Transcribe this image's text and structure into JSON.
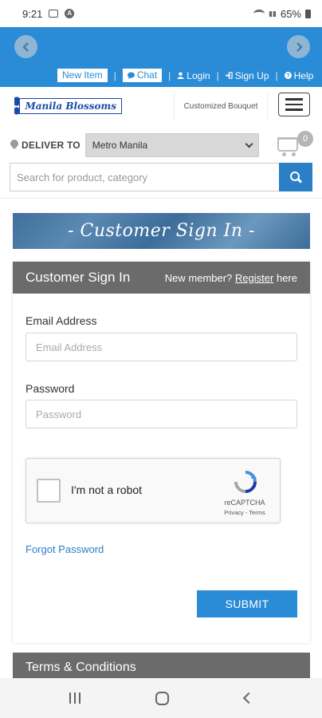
{
  "status_bar": {
    "time": "9:21",
    "battery": "65%"
  },
  "top_links": {
    "new_item": "New Item",
    "chat": "Chat",
    "login": "Login",
    "signup": "Sign Up",
    "help": "Help"
  },
  "header": {
    "logo_text": "Manila Blossoms",
    "bouquet_link": "Customized Bouquet"
  },
  "deliver": {
    "label": "DELIVER TO",
    "selected": "Metro Manila",
    "cart_count": "0"
  },
  "search": {
    "placeholder": "Search for product, category"
  },
  "banner": {
    "text": "- Customer Sign In -"
  },
  "signin": {
    "title": "Customer Sign In",
    "new_member": "New member?",
    "register": "Register",
    "here": "here",
    "email_label": "Email Address",
    "email_placeholder": "Email Address",
    "password_label": "Password",
    "password_placeholder": "Password",
    "captcha_text": "I'm not a robot",
    "captcha_brand": "reCAPTCHA",
    "captcha_links": "Privacy - Terms",
    "forgot": "Forgot Password",
    "submit": "SUBMIT"
  },
  "terms": {
    "title": "Terms & Conditions"
  },
  "colors": {
    "accent": "#2a8bd6",
    "header_gray": "#6b6b6b",
    "link": "#2a7fc7"
  }
}
